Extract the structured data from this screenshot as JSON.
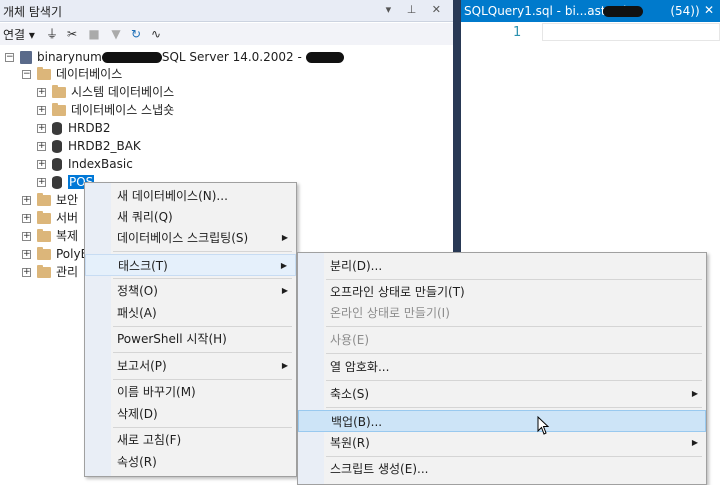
{
  "object_explorer": {
    "title": "개체 탐색기",
    "title_buttons": "▾ ⊥ ✕",
    "toolbar": {
      "connect_label": "연결",
      "icons": [
        "connect-plug-icon",
        "disconnect-plug-icon",
        "stop-icon",
        "filter-icon",
        "refresh-icon",
        "activity-monitor-icon"
      ]
    },
    "tree": {
      "server_name_start": "binarynum",
      "server_label": "SQL Server 14.0.2002 -",
      "databases_label": "데이터베이스",
      "system_db_label": "시스템 데이터베이스",
      "snapshot_label": "데이터베이스 스냅숏",
      "db_items": [
        "HRDB2",
        "HRDB2_BAK",
        "IndexBasic",
        "POS"
      ],
      "other_folders": [
        "보안",
        "서버",
        "복제",
        "PolyB",
        "관리"
      ]
    }
  },
  "editor": {
    "tab_label": "SQLQuery1.sql - bi...aster (",
    "tab_suffix": "(54))",
    "tab_close": "✕",
    "line_number": "1"
  },
  "context_menu": {
    "items": [
      {
        "label": "새 데이터베이스(N)...",
        "submenu": false
      },
      {
        "label": "새 쿼리(Q)",
        "submenu": false
      },
      {
        "label": "데이터베이스 스크립팅(S)",
        "submenu": true
      },
      {
        "label": "태스크(T)",
        "submenu": true,
        "active": true
      },
      {
        "label": "정책(O)",
        "submenu": true
      },
      {
        "label": "패싯(A)",
        "submenu": false
      },
      {
        "label": "PowerShell 시작(H)",
        "submenu": false
      },
      {
        "label": "보고서(P)",
        "submenu": true
      },
      {
        "label": "이름 바꾸기(M)",
        "submenu": false
      },
      {
        "label": "삭제(D)",
        "submenu": false
      },
      {
        "label": "새로 고침(F)",
        "submenu": false
      },
      {
        "label": "속성(R)",
        "submenu": false
      }
    ]
  },
  "task_submenu": {
    "items": [
      {
        "label": "분리(D)...",
        "submenu": false,
        "disabled": false
      },
      {
        "label": "오프라인 상태로 만들기(T)",
        "submenu": false,
        "disabled": false
      },
      {
        "label": "온라인 상태로 만들기(I)",
        "submenu": false,
        "disabled": true
      },
      {
        "label": "사용(E)",
        "submenu": false,
        "disabled": true
      },
      {
        "label": "열 암호화...",
        "submenu": false,
        "disabled": false
      },
      {
        "label": "축소(S)",
        "submenu": true,
        "disabled": false
      },
      {
        "label": "백업(B)...",
        "submenu": false,
        "disabled": false,
        "hovered": true
      },
      {
        "label": "복원(R)",
        "submenu": true,
        "disabled": false
      },
      {
        "label": "스크립트 생성(E)...",
        "submenu": false,
        "disabled": false
      }
    ]
  },
  "submenu_arrow": "▶"
}
